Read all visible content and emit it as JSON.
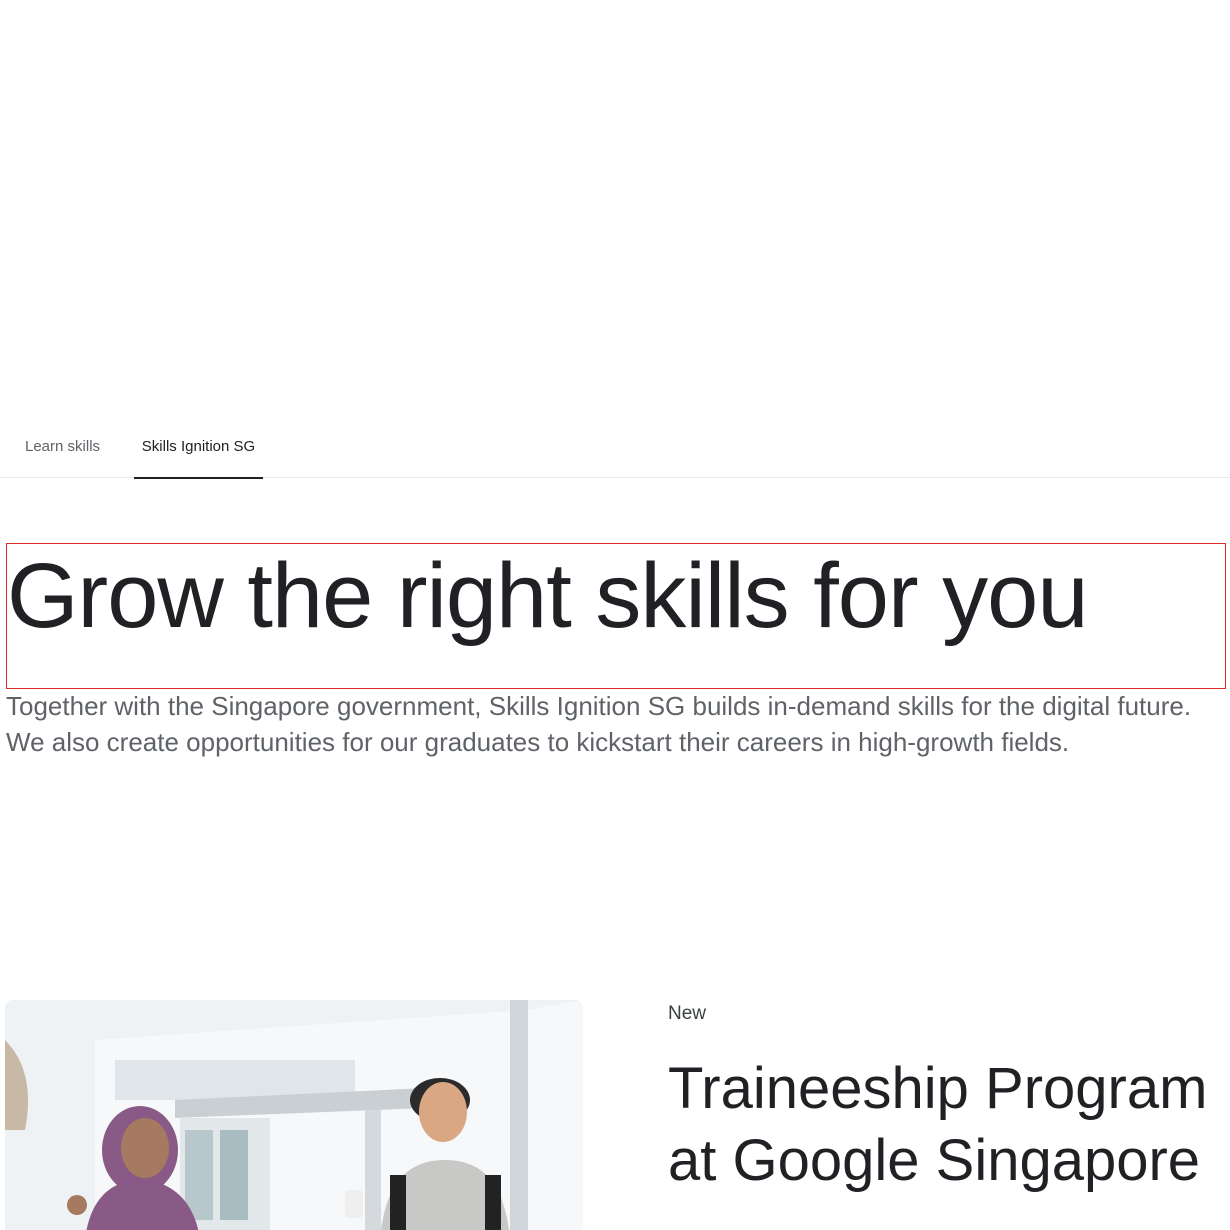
{
  "subnav": {
    "tabs": [
      {
        "label": "Learn skills",
        "active": false
      },
      {
        "label": "Skills Ignition SG",
        "active": true
      }
    ]
  },
  "hero": {
    "heading": "Grow the right skills for you",
    "intro": "Together with the Singapore government, Skills Ignition SG builds in-demand skills for the digital future. We also create opportunities for our graduates to kickstart their careers in high-growth fields."
  },
  "program": {
    "badge": "New",
    "title": "Traineeship Program at Google Singapore",
    "image_icon": "photo-two-students"
  },
  "colors": {
    "text_primary": "#202124",
    "text_secondary": "#5f6368",
    "divider": "#e8eaed",
    "highlight_outline": "#d93025"
  }
}
